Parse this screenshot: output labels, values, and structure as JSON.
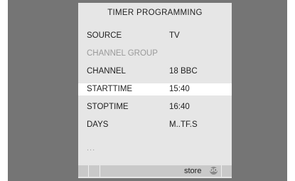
{
  "menu": {
    "title": "TIMER PROGRAMMING",
    "rows": [
      {
        "label": "SOURCE",
        "value": "TV"
      },
      {
        "label": "CHANNEL GROUP",
        "value": ""
      },
      {
        "label": "CHANNEL",
        "value": "18 BBC"
      },
      {
        "label": "STARTTIME",
        "value": "15:40"
      },
      {
        "label": "STOPTIME",
        "value": "16:40"
      },
      {
        "label": "DAYS",
        "value": "M..TF.S"
      }
    ],
    "more": "...",
    "status": {
      "store_label": "store",
      "go_icon": "go-button-icon"
    }
  }
}
